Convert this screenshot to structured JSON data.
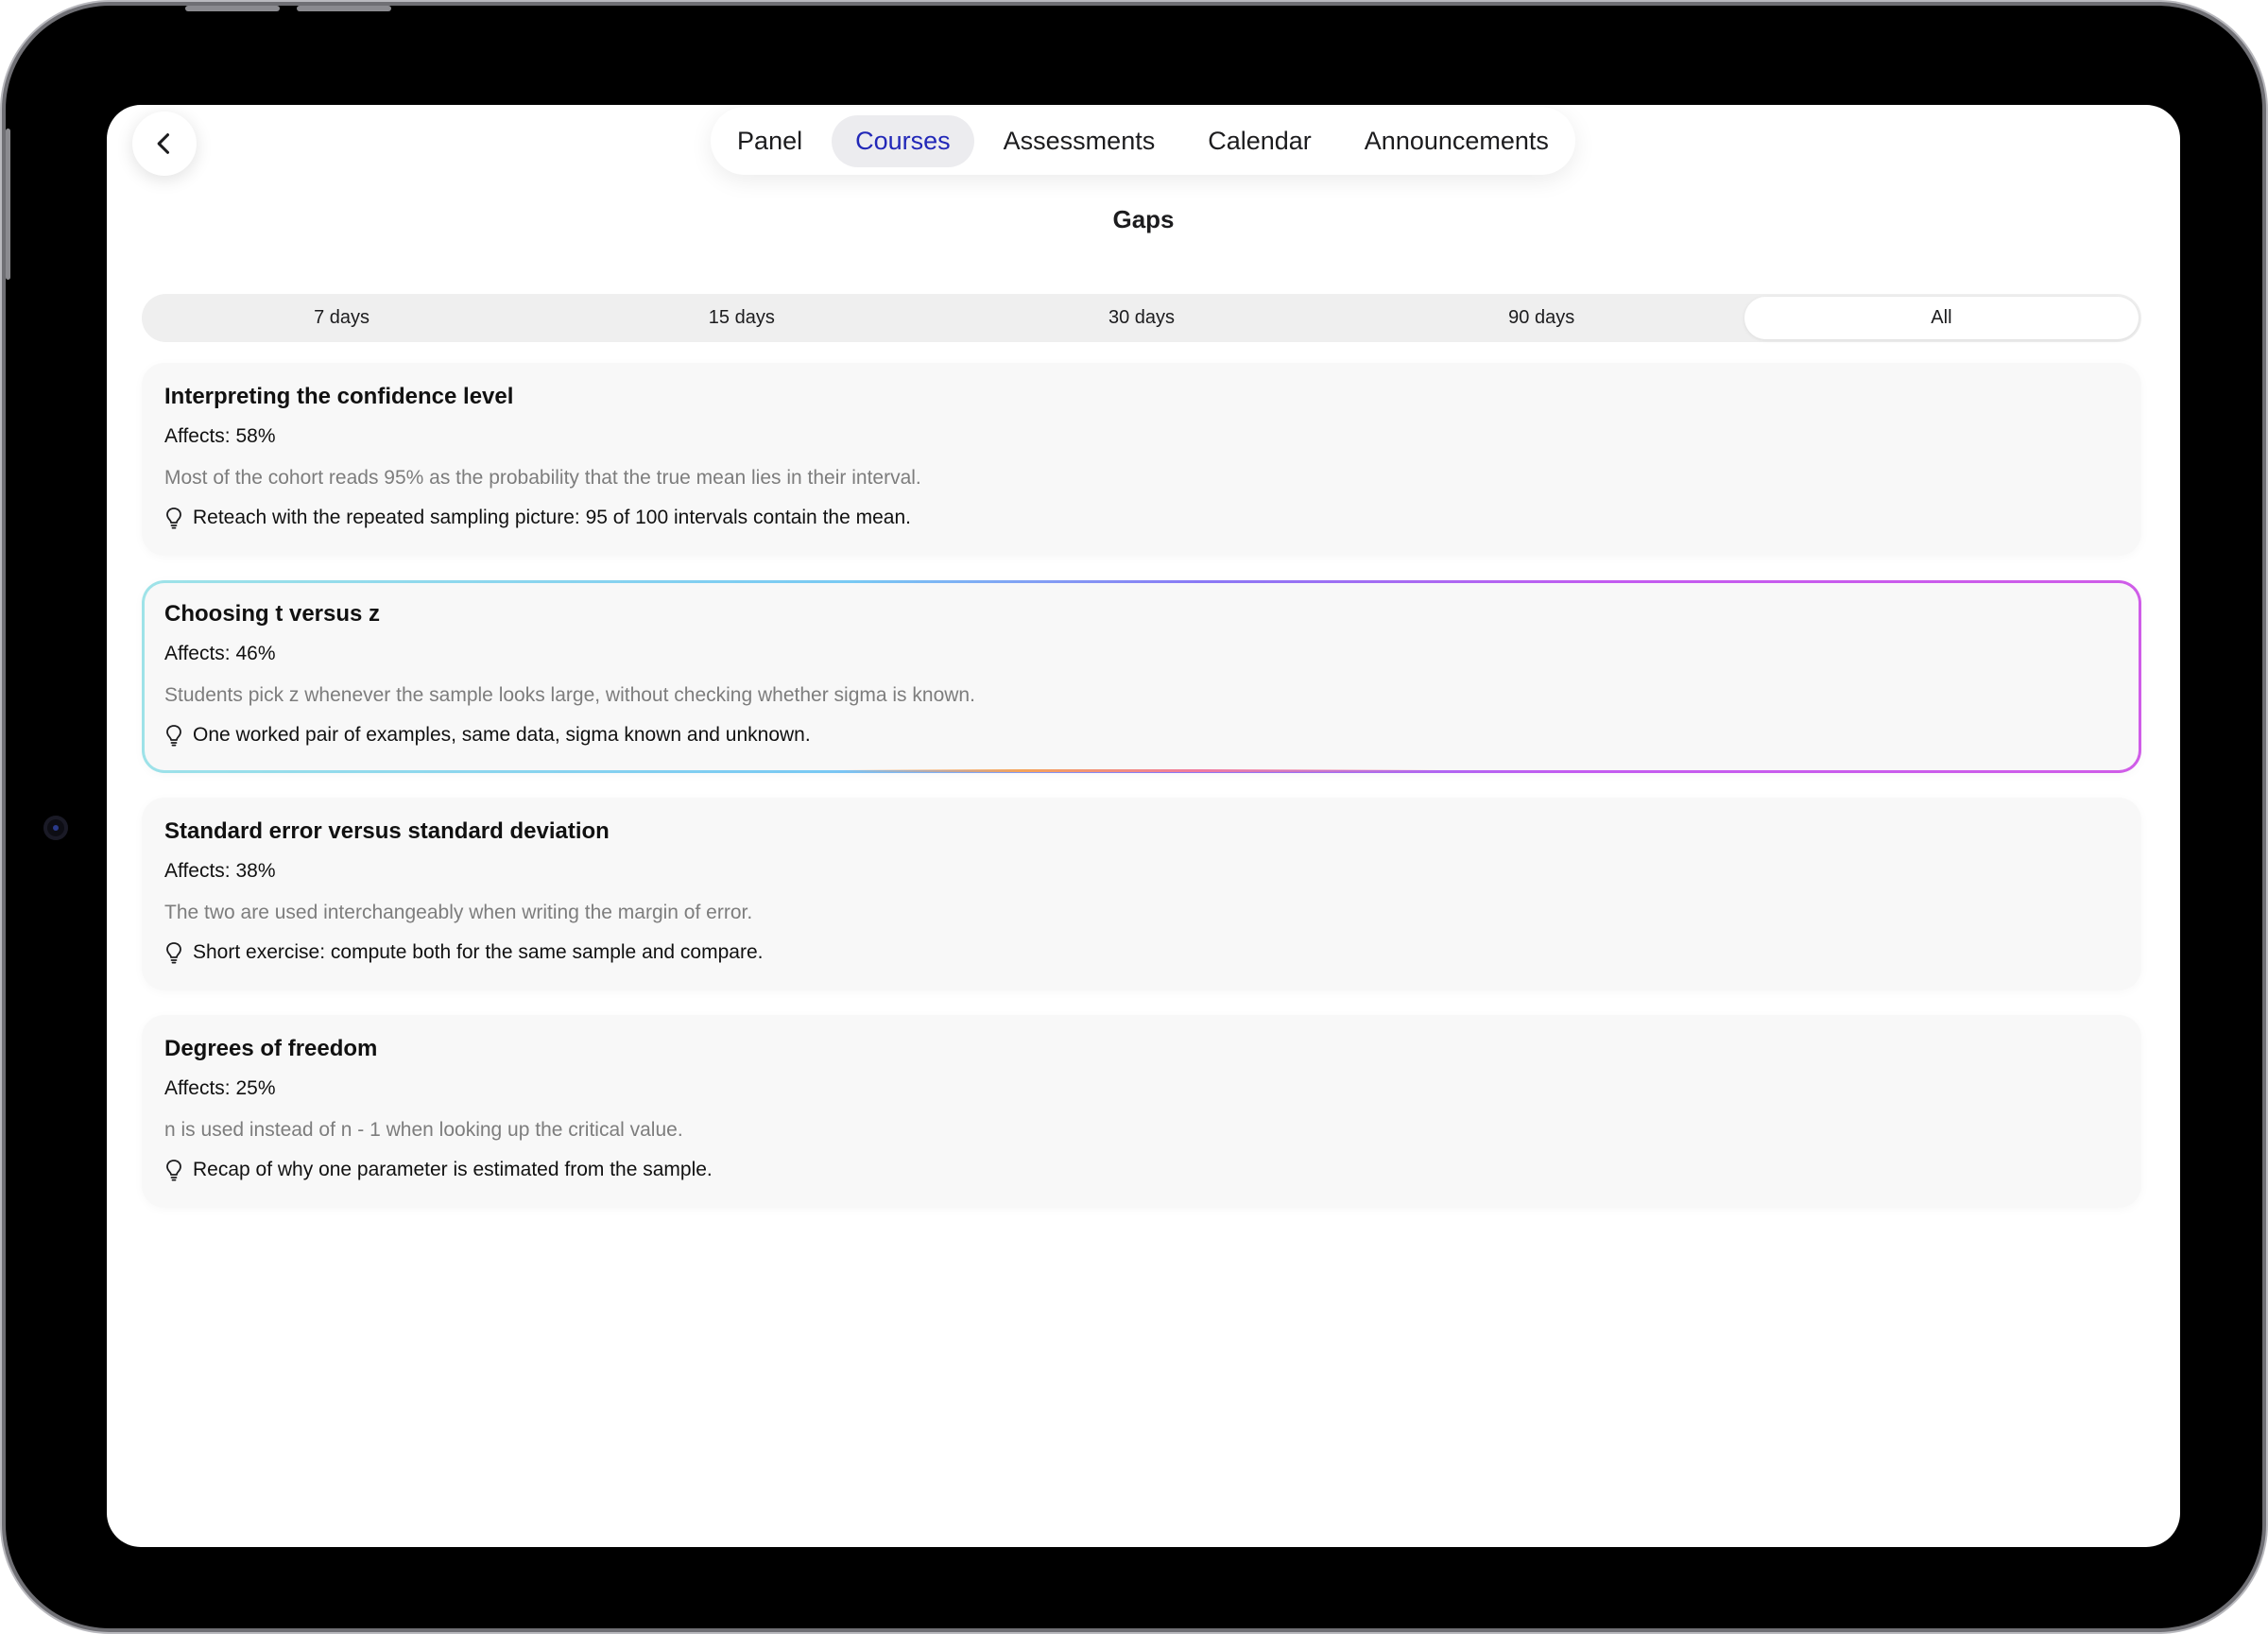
{
  "nav": {
    "back_icon": "chevron-left-icon",
    "tabs": [
      {
        "label": "Panel",
        "active": false
      },
      {
        "label": "Courses",
        "active": true
      },
      {
        "label": "Assessments",
        "active": false
      },
      {
        "label": "Calendar",
        "active": false
      },
      {
        "label": "Announcements",
        "active": false
      }
    ],
    "active_color": "#2228b8"
  },
  "page": {
    "title": "Gaps"
  },
  "range_filter": {
    "options": [
      "7 days",
      "15 days",
      "30 days",
      "90 days",
      "All"
    ],
    "selected": "All"
  },
  "gaps": [
    {
      "title": "Interpreting the confidence level",
      "affects": "Affects: 58%",
      "description": "Most of the cohort reads 95% as the probability that the true mean lies in their interval.",
      "tip": "Reteach with the repeated sampling picture: 95 of 100 intervals contain the mean.",
      "tip_icon": "lightbulb-icon",
      "highlighted": false
    },
    {
      "title": "Choosing t versus z",
      "affects": "Affects: 46%",
      "description": "Students pick z whenever the sample looks large, without checking whether sigma is known.",
      "tip": "One worked pair of examples, same data, sigma known and unknown.",
      "tip_icon": "lightbulb-icon",
      "highlighted": true
    },
    {
      "title": "Standard error versus standard deviation",
      "affects": "Affects: 38%",
      "description": "The two are used interchangeably when writing the margin of error.",
      "tip": "Short exercise: compute both for the same sample and compare.",
      "tip_icon": "lightbulb-icon",
      "highlighted": false
    },
    {
      "title": "Degrees of freedom",
      "affects": "Affects: 25%",
      "description": "n is used instead of n - 1 when looking up the critical value.",
      "tip": "Recap of why one parameter is estimated from the sample.",
      "tip_icon": "lightbulb-icon",
      "highlighted": false
    }
  ]
}
